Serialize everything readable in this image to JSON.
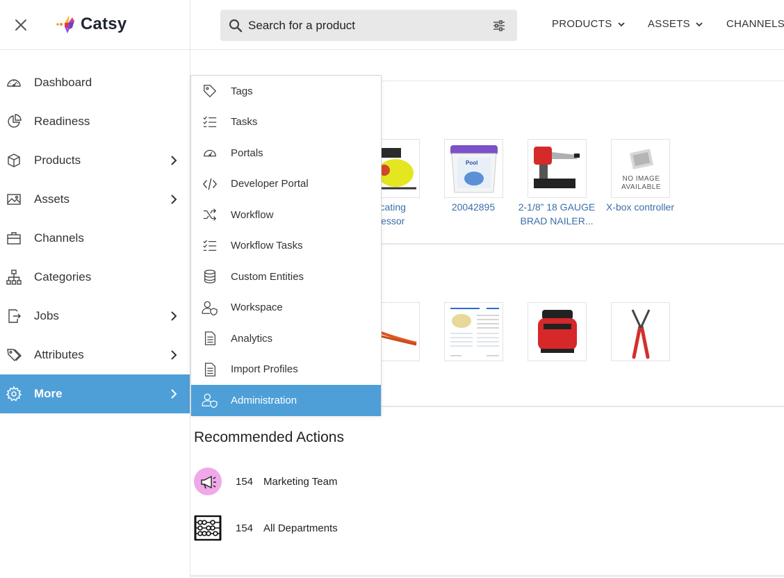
{
  "header": {
    "brand": "Catsy",
    "search_placeholder": "Search for a product",
    "nav": [
      "PRODUCTS",
      "ASSETS",
      "CHANNELS"
    ]
  },
  "sidebar": {
    "items": [
      {
        "label": "Dashboard",
        "icon": "dashboard-gauge-icon",
        "has_submenu": false
      },
      {
        "label": "Readiness",
        "icon": "pie-chart-icon",
        "has_submenu": false
      },
      {
        "label": "Products",
        "icon": "cube-icon",
        "has_submenu": true
      },
      {
        "label": "Assets",
        "icon": "image-icon",
        "has_submenu": true
      },
      {
        "label": "Channels",
        "icon": "briefcase-icon",
        "has_submenu": false
      },
      {
        "label": "Categories",
        "icon": "hierarchy-icon",
        "has_submenu": false
      },
      {
        "label": "Jobs",
        "icon": "file-export-icon",
        "has_submenu": true
      },
      {
        "label": "Attributes",
        "icon": "tags-icon",
        "has_submenu": true
      },
      {
        "label": "More",
        "icon": "gear-icon",
        "has_submenu": true,
        "active": true
      }
    ]
  },
  "more_menu": {
    "items": [
      {
        "label": "Tags",
        "icon": "tag-icon"
      },
      {
        "label": "Tasks",
        "icon": "checklist-icon"
      },
      {
        "label": "Portals",
        "icon": "gauge-icon"
      },
      {
        "label": "Developer Portal",
        "icon": "code-icon"
      },
      {
        "label": "Workflow",
        "icon": "shuffle-icon"
      },
      {
        "label": "Workflow Tasks",
        "icon": "checklist-icon"
      },
      {
        "label": "Custom Entities",
        "icon": "database-icon"
      },
      {
        "label": "Workspace",
        "icon": "user-shield-icon"
      },
      {
        "label": "Analytics",
        "icon": "document-icon"
      },
      {
        "label": "Import Profiles",
        "icon": "document-icon"
      },
      {
        "label": "Administration",
        "icon": "user-shield-icon",
        "active": true
      }
    ]
  },
  "recent_products": [
    {
      "caption": "...procating\n...pressor",
      "visible_caption_line1": "rocating",
      "visible_caption_line2": "pressor"
    },
    {
      "caption": "20042895"
    },
    {
      "caption": "2-1/8\" 18 GAUGE BRAD NAILER...",
      "line1": "2-1/8” 18 GAUGE",
      "line2": "BRAD NAILER..."
    },
    {
      "caption": "X-box controller"
    }
  ],
  "no_image_text": {
    "line1": "NO IMAGE",
    "line2": "AVAILABLE"
  },
  "recommended": {
    "title": "Recommended Actions",
    "items": [
      {
        "count": "154",
        "label": "Marketing Team",
        "icon": "megaphone-icon"
      },
      {
        "count": "154",
        "label": "All Departments",
        "icon": "abacus-icon"
      }
    ]
  },
  "colors": {
    "accent": "#4e9fd8",
    "link": "#3a6ea8"
  }
}
